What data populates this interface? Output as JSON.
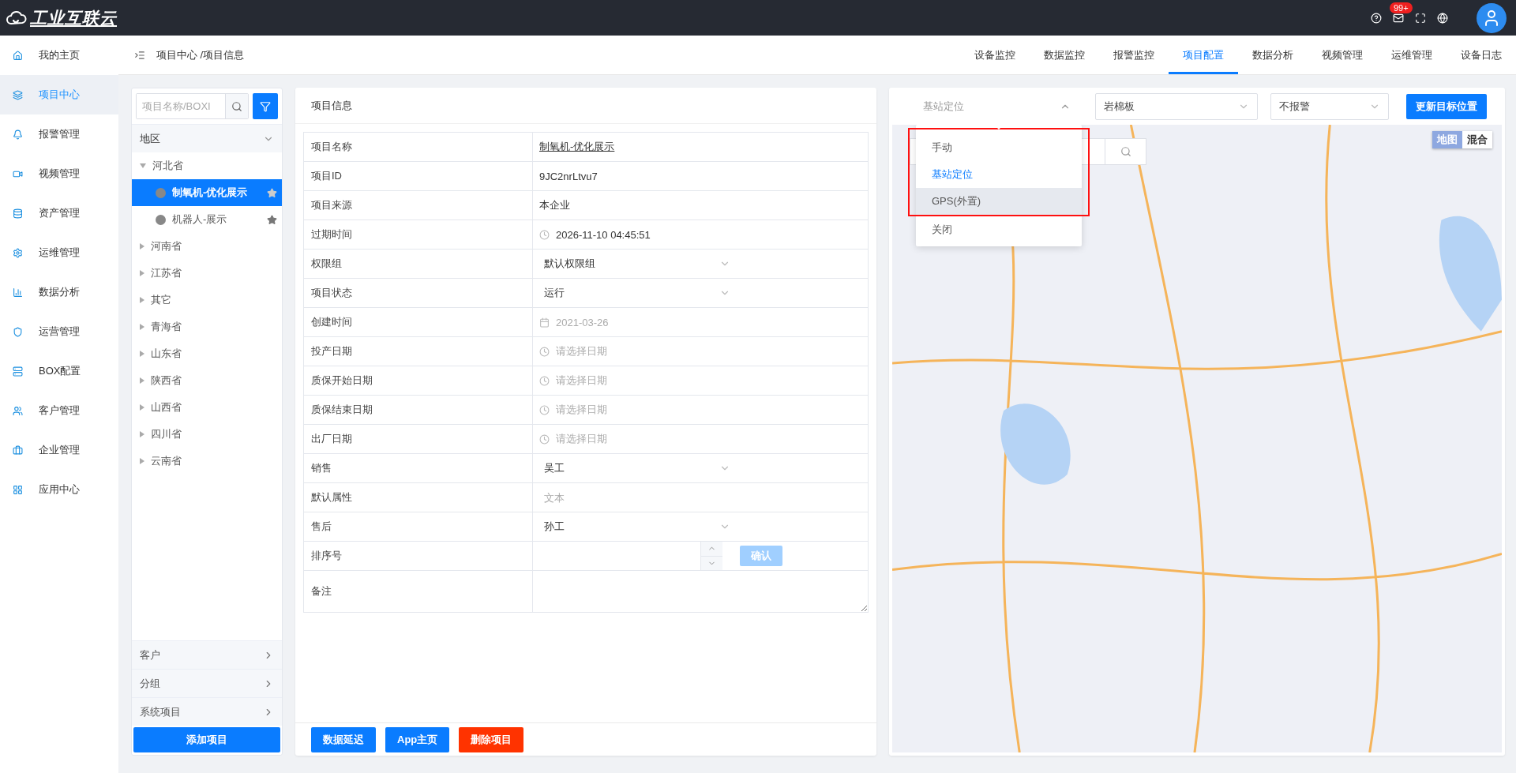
{
  "header": {
    "logo_text": "工业互联云",
    "mail_badge": "99+"
  },
  "sidebar": {
    "items": [
      {
        "label": "我的主页",
        "selected": false
      },
      {
        "label": "项目中心",
        "selected": true
      },
      {
        "label": "报警管理",
        "selected": false
      },
      {
        "label": "视频管理",
        "selected": false
      },
      {
        "label": "资产管理",
        "selected": false
      },
      {
        "label": "运维管理",
        "selected": false
      },
      {
        "label": "数据分析",
        "selected": false
      },
      {
        "label": "运营管理",
        "selected": false
      },
      {
        "label": "BOX配置",
        "selected": false
      },
      {
        "label": "客户管理",
        "selected": false
      },
      {
        "label": "企业管理",
        "selected": false
      },
      {
        "label": "应用中心",
        "selected": false
      }
    ]
  },
  "breadcrumb": "项目中心 /项目信息",
  "top_tabs": [
    {
      "label": "设备监控",
      "selected": false
    },
    {
      "label": "数据监控",
      "selected": false
    },
    {
      "label": "报警监控",
      "selected": false
    },
    {
      "label": "项目配置",
      "selected": true
    },
    {
      "label": "数据分析",
      "selected": false
    },
    {
      "label": "视频管理",
      "selected": false
    },
    {
      "label": "运维管理",
      "selected": false
    },
    {
      "label": "设备日志",
      "selected": false
    }
  ],
  "tree": {
    "search_placeholder": "项目名称/BOXI",
    "group_label": "地区",
    "nodes": [
      {
        "label": "河北省",
        "expanded": true,
        "children": [
          {
            "label": "制氧机-优化展示",
            "selected": true
          },
          {
            "label": "机器人-展示",
            "selected": false
          }
        ]
      },
      {
        "label": "河南省",
        "expanded": false
      },
      {
        "label": "江苏省",
        "expanded": false
      },
      {
        "label": "其它",
        "expanded": false
      },
      {
        "label": "青海省",
        "expanded": false
      },
      {
        "label": "山东省",
        "expanded": false
      },
      {
        "label": "陕西省",
        "expanded": false
      },
      {
        "label": "山西省",
        "expanded": false
      },
      {
        "label": "四川省",
        "expanded": false
      },
      {
        "label": "云南省",
        "expanded": false
      }
    ],
    "groups": [
      "客户",
      "分组",
      "系统项目"
    ],
    "add_button": "添加项目"
  },
  "info": {
    "title": "项目信息",
    "rows": [
      {
        "label": "项目名称",
        "kind": "link",
        "value": "制氧机-优化展示"
      },
      {
        "label": "项目ID",
        "kind": "text",
        "value": "9JC2nrLtvu7"
      },
      {
        "label": "项目来源",
        "kind": "text",
        "value": "本企业"
      },
      {
        "label": "过期时间",
        "kind": "time",
        "value": "2026-11-10 04:45:51",
        "disabled": false
      },
      {
        "label": "权限组",
        "kind": "select",
        "value": "默认权限组"
      },
      {
        "label": "项目状态",
        "kind": "select",
        "value": "运行"
      },
      {
        "label": "创建时间",
        "kind": "date",
        "value": "2021-03-26",
        "disabled": true
      },
      {
        "label": "投产日期",
        "kind": "time",
        "placeholder": "请选择日期"
      },
      {
        "label": "质保开始日期",
        "kind": "time",
        "placeholder": "请选择日期"
      },
      {
        "label": "质保结束日期",
        "kind": "time",
        "placeholder": "请选择日期"
      },
      {
        "label": "出厂日期",
        "kind": "time",
        "placeholder": "请选择日期"
      },
      {
        "label": "销售",
        "kind": "select",
        "value": "吴工"
      },
      {
        "label": "默认属性",
        "kind": "input",
        "placeholder": "文本"
      },
      {
        "label": "售后",
        "kind": "select",
        "value": "孙工"
      },
      {
        "label": "排序号",
        "kind": "number",
        "confirm": {
          "label": "确认",
          "disabled": true
        }
      },
      {
        "label": "备注",
        "kind": "textarea"
      }
    ],
    "buttons": [
      {
        "label": "数据延迟",
        "kind": "primary"
      },
      {
        "label": "App主页",
        "kind": "primary"
      },
      {
        "label": "删除项目",
        "kind": "danger"
      }
    ]
  },
  "map": {
    "position_select": {
      "value": "基站定位",
      "open": true,
      "options": [
        {
          "label": "手动",
          "selected": false,
          "hovered": false,
          "framed": true
        },
        {
          "label": "基站定位",
          "selected": true,
          "hovered": false,
          "framed": true
        },
        {
          "label": "GPS(外置)",
          "selected": false,
          "hovered": true,
          "framed": true
        },
        {
          "label": "关闭",
          "selected": false,
          "hovered": false,
          "framed": false
        }
      ]
    },
    "material_select": "岩棉板",
    "alarm_select": "不报警",
    "update_button": "更新目标位置",
    "map_types": [
      {
        "label": "地图",
        "selected": true
      },
      {
        "label": "混合",
        "selected": false
      }
    ]
  }
}
